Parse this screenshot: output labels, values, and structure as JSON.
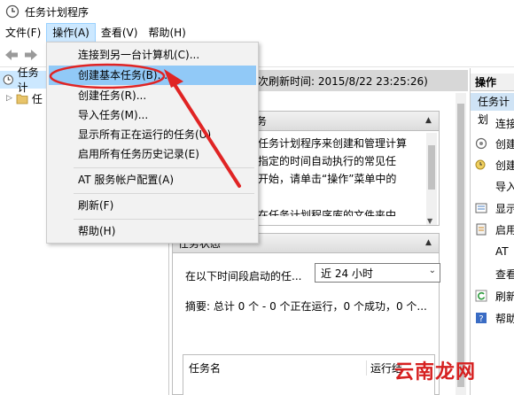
{
  "window": {
    "title": "任务计划程序"
  },
  "menubar": {
    "file": "文件(F)",
    "action": "操作(A)",
    "view": "查看(V)",
    "help": "帮助(H)"
  },
  "tree": {
    "root": "任务计",
    "library": "任"
  },
  "center": {
    "header": "次刷新时间: 2015/8/22 23:25:26)",
    "overview_head": "务",
    "overview_lines": [
      "任务计划程序来创建和管理计算",
      "指定的时间自动执行的常见任",
      "开始，请单击“操作”菜单中的",
      "在任务计划程序库的文件夹中"
    ],
    "status_head": "任务状态",
    "status_label": "在以下时间段启动的任...",
    "status_select": "近 24 小时",
    "summary": "摘要: 总计 0 个 - 0 个正在运行，0 个成功，0 个...",
    "col_name": "任务名",
    "col_result": "运行结"
  },
  "right": {
    "header": "操作",
    "sub": "任务计划",
    "items": [
      "连接",
      "创建",
      "创建",
      "导入",
      "显示",
      "启用",
      "AT",
      "查看",
      "刷新",
      "帮助"
    ]
  },
  "dropdown": {
    "items": [
      "连接到另一台计算机(C)...",
      "创建基本任务(B)...",
      "创建任务(R)...",
      "导入任务(M)...",
      "显示所有正在运行的任务(U)",
      "启用所有任务历史记录(E)",
      "AT 服务帐户配置(A)",
      "刷新(F)",
      "帮助(H)"
    ]
  },
  "watermark": "云南龙网",
  "colors": {
    "menu_highlight": "#91c9f7",
    "annotation": "#e02424",
    "header_gray": "#d7d7d7"
  }
}
